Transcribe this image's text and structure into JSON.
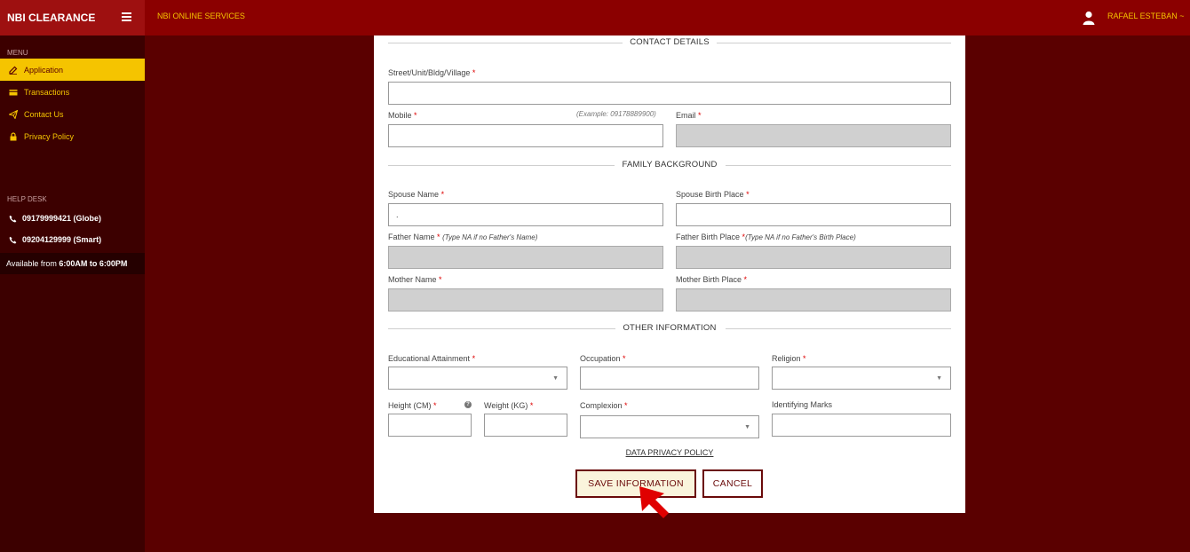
{
  "app": {
    "brand": "NBI CLEARANCE",
    "services": "NBI ONLINE SERVICES",
    "user": "RAFAEL ESTEBAN ~"
  },
  "sidebar": {
    "menu_heading": "MENU",
    "items": [
      {
        "label": "Application",
        "icon": "pen-icon",
        "active": true
      },
      {
        "label": "Transactions",
        "icon": "card-icon",
        "active": false
      },
      {
        "label": "Contact Us",
        "icon": "send-icon",
        "active": false
      },
      {
        "label": "Privacy Policy",
        "icon": "lock-icon",
        "active": false
      }
    ],
    "help_heading": "HELP DESK",
    "phones": [
      "09179999421 (Globe)",
      "09204129999 (Smart)"
    ],
    "available_prefix": "Available from ",
    "available_hours": "6:00AM to 6:00PM"
  },
  "form": {
    "contact_title": "CONTACT DETAILS",
    "street_label": "Street/Unit/Bldg/Village",
    "street_value": "",
    "mobile_label": "Mobile",
    "mobile_hint": "(Example: 09178889900)",
    "mobile_value": "",
    "email_label": "Email",
    "email_value": "",
    "family_title": "FAMILY BACKGROUND",
    "spouse_name_label": "Spouse Name",
    "spouse_name_value": ".",
    "spouse_birth_label": "Spouse Birth Place",
    "spouse_birth_value": "",
    "father_name_label": "Father Name",
    "father_name_note": "(Type NA if no Father's Name)",
    "father_name_value": "",
    "father_birth_label": "Father Birth Place",
    "father_birth_note": "(Type NA if no Father's Birth Place)",
    "father_birth_value": "",
    "mother_name_label": "Mother Name",
    "mother_name_value": "",
    "mother_birth_label": "Mother Birth Place",
    "mother_birth_value": "",
    "other_title": "OTHER INFORMATION",
    "education_label": "Educational Attainment",
    "education_value": "",
    "occupation_label": "Occupation",
    "occupation_value": "",
    "religion_label": "Religion",
    "religion_value": "",
    "height_label": "Height (CM)",
    "height_value": "",
    "weight_label": "Weight (KG)",
    "weight_value": "",
    "complexion_label": "Complexion",
    "complexion_value": "",
    "marks_label": "Identifying Marks",
    "marks_value": "",
    "required_mark": "*",
    "help_mark": "?",
    "privacy_link": "DATA PRIVACY POLICY",
    "save_button": "SAVE INFORMATION",
    "cancel_button": "CANCEL"
  },
  "colors": {
    "topbar": "#8b0000",
    "sidebar": "#3c0000",
    "accent": "#f5c400",
    "background": "#5a0000",
    "button_border": "#6a0a0a"
  }
}
